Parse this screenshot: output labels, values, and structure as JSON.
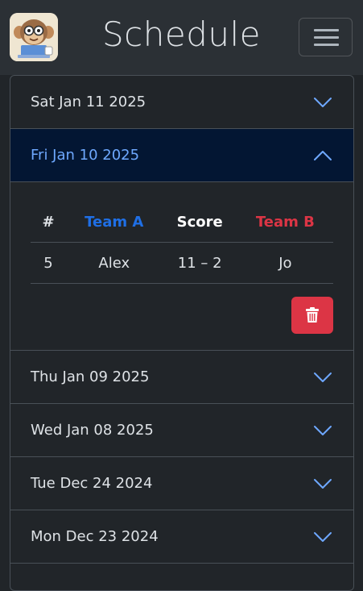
{
  "navbar": {
    "title": "Schedule",
    "logo_icon": "monkey-mascot-logo",
    "menu_icon": "hamburger-icon"
  },
  "accordion": {
    "items": [
      {
        "date": "Sat Jan 11 2025",
        "expanded": false
      },
      {
        "date": "Fri Jan 10 2025",
        "expanded": true
      },
      {
        "date": "Thu Jan 09 2025",
        "expanded": false
      },
      {
        "date": "Wed Jan 08 2025",
        "expanded": false
      },
      {
        "date": "Tue Dec 24 2024",
        "expanded": false
      },
      {
        "date": "Mon Dec 23 2024",
        "expanded": false
      }
    ]
  },
  "game_table": {
    "headers": {
      "number": "#",
      "team_a": "Team A",
      "score": "Score",
      "team_b": "Team B"
    },
    "rows": [
      {
        "number": "5",
        "team_a": "Alex",
        "score": "11 – 2",
        "team_b": "Jo"
      }
    ],
    "delete_icon": "trash-icon"
  },
  "colors": {
    "background": "#212529",
    "navbar": "#2b3035",
    "active_header_bg": "#031633",
    "active_header_text": "#6ea8fe",
    "team_a": "#1f6fe5",
    "team_b": "#dc3545",
    "delete_button": "#dc3545"
  }
}
